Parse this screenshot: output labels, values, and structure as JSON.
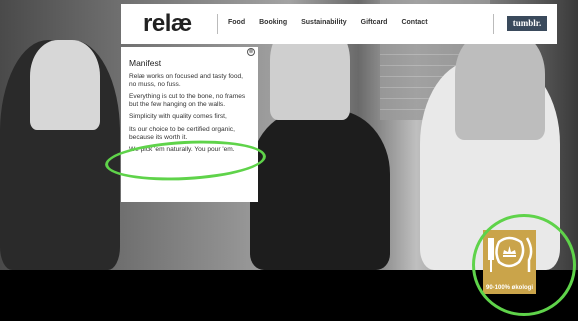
{
  "header": {
    "logo": "relæ",
    "links": [
      "Food",
      "Booking",
      "Sustainability",
      "Giftcard",
      "Contact"
    ],
    "social_label": "tumblr."
  },
  "panel": {
    "title": "Manifest",
    "paragraphs": [
      "Relæ works on focused and tasty food, no muss, no fuss.",
      "Everything is cut to the bone, no frames but the few hanging on the walls.",
      "Simplicity with quality comes first,",
      "Its our choice to be certified organic, because its worth it.",
      "We pick 'em naturally. You pour 'em."
    ],
    "close_symbol": "⊗"
  },
  "badge": {
    "label": "90-100% økologi",
    "color": "#caa44a"
  },
  "colors": {
    "highlight": "#5fd34a",
    "social": "#3a4a5c"
  }
}
